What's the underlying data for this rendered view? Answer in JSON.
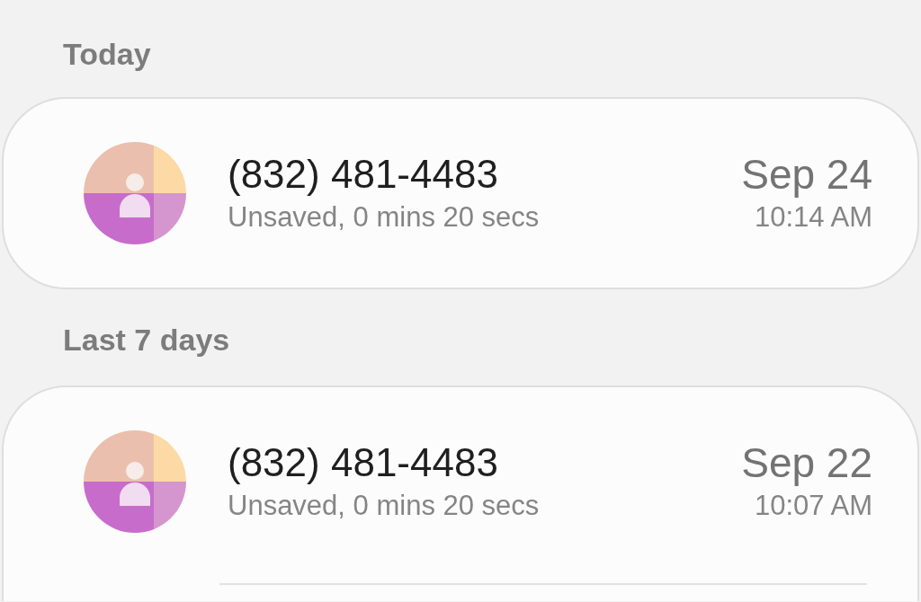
{
  "sections": [
    {
      "header": "Today",
      "calls": [
        {
          "number": "(832) 481-4483",
          "detail": "Unsaved, 0 mins 20 secs",
          "date": "Sep 24",
          "time": "10:14 AM"
        }
      ]
    },
    {
      "header": "Last 7 days",
      "calls": [
        {
          "number": "(832) 481-4483",
          "detail": "Unsaved, 0 mins 20 secs",
          "date": "Sep 22",
          "time": "10:07 AM"
        }
      ]
    }
  ]
}
